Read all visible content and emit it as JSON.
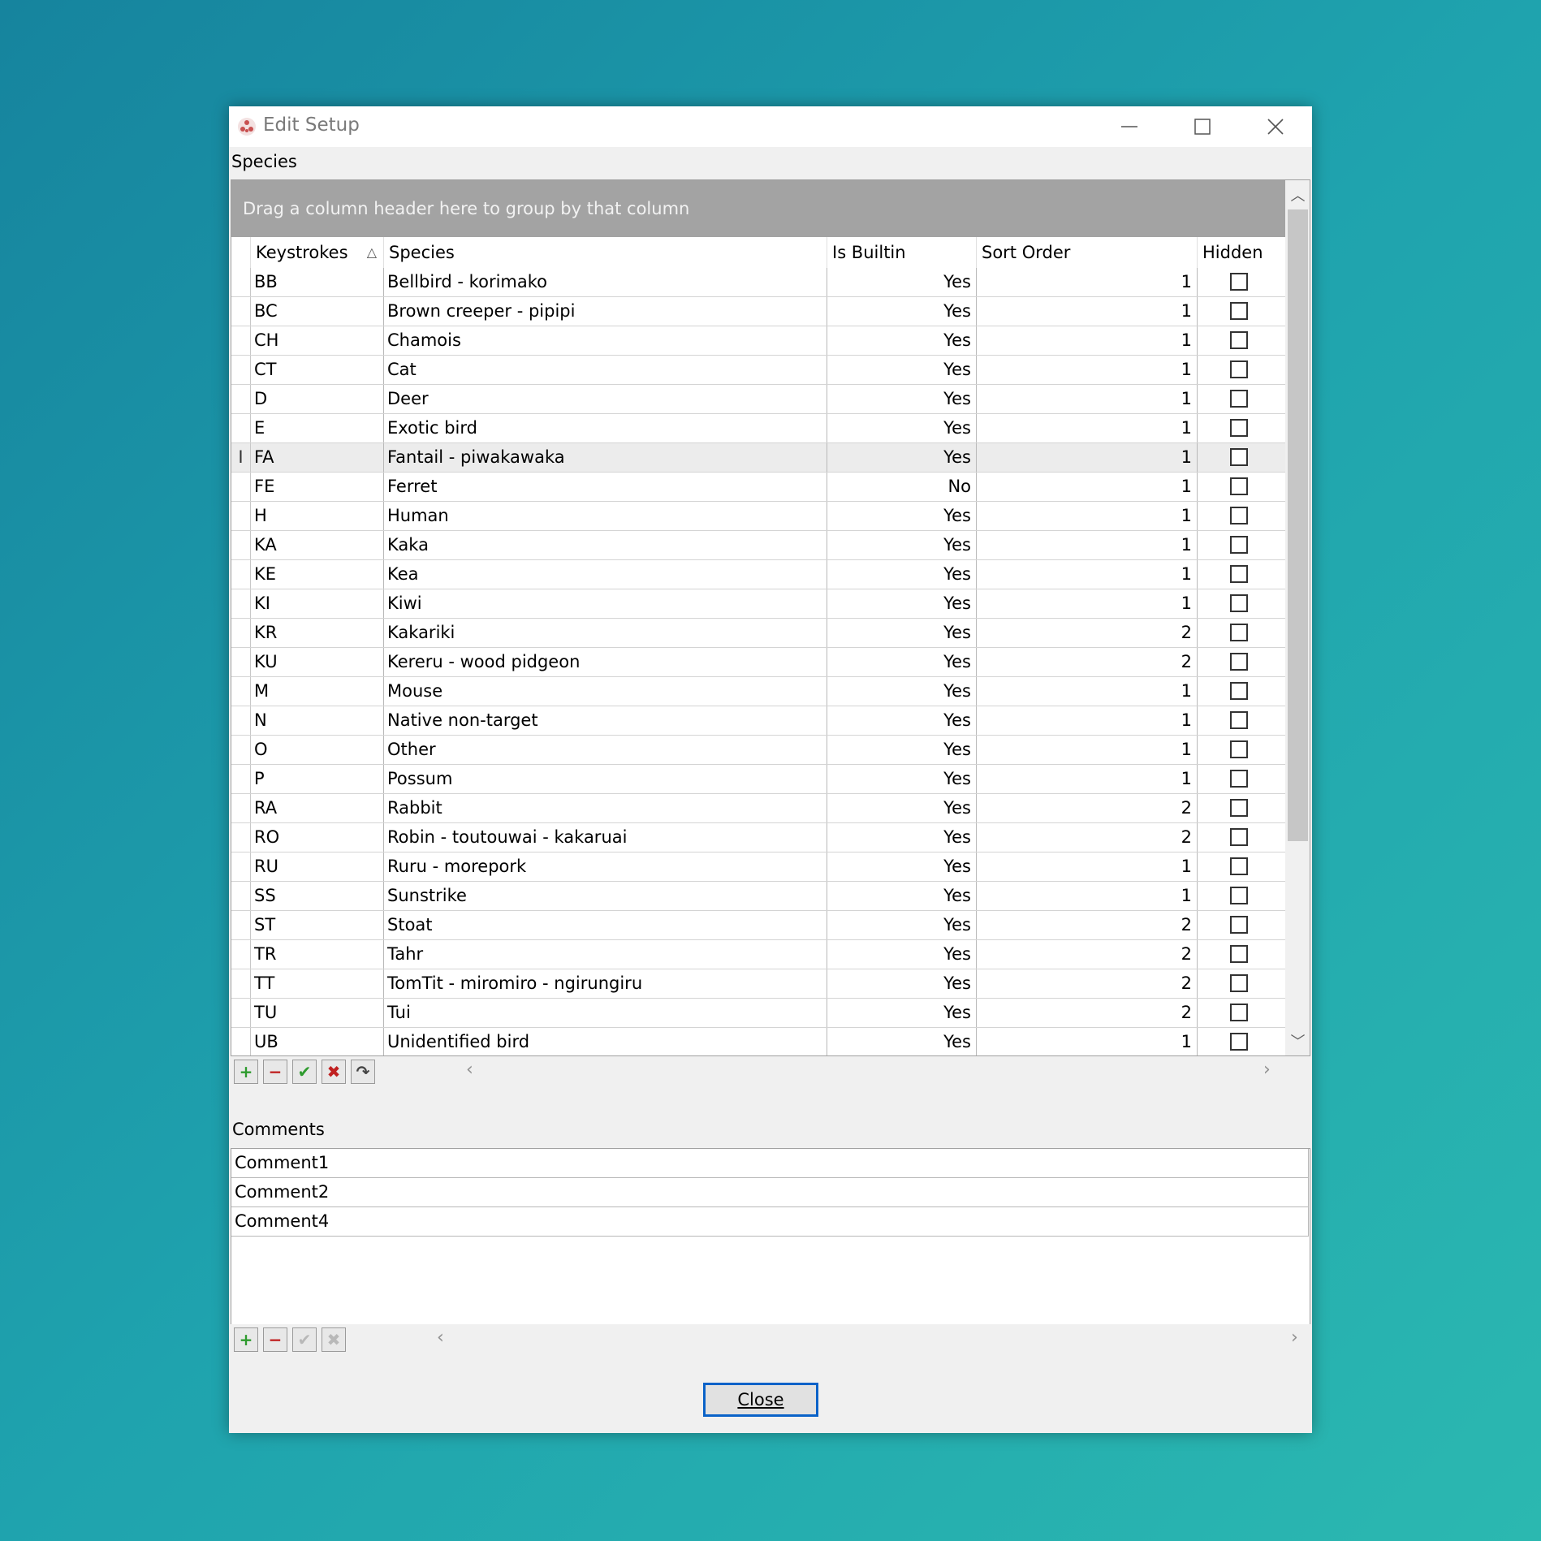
{
  "window": {
    "title": "Edit Setup"
  },
  "species_section": {
    "label": "Species",
    "group_hint": "Drag a column header here to group by that column",
    "columns": [
      "Keystrokes",
      "Species",
      "Is Builtin",
      "Sort Order",
      "Hidden"
    ],
    "sort_indicator": "△",
    "rows": [
      {
        "key": "BB",
        "species": "Bellbird - korimako",
        "builtin": "Yes",
        "sort": "1"
      },
      {
        "key": "BC",
        "species": "Brown creeper - pipipi",
        "builtin": "Yes",
        "sort": "1"
      },
      {
        "key": "CH",
        "species": "Chamois",
        "builtin": "Yes",
        "sort": "1"
      },
      {
        "key": "CT",
        "species": "Cat",
        "builtin": "Yes",
        "sort": "1"
      },
      {
        "key": "D",
        "species": "Deer",
        "builtin": "Yes",
        "sort": "1"
      },
      {
        "key": "E",
        "species": "Exotic bird",
        "builtin": "Yes",
        "sort": "1"
      },
      {
        "key": "FA",
        "species": "Fantail - piwakawaka",
        "builtin": "Yes",
        "sort": "1"
      },
      {
        "key": "FE",
        "species": "Ferret",
        "builtin": "No",
        "sort": "1"
      },
      {
        "key": "H",
        "species": "Human",
        "builtin": "Yes",
        "sort": "1"
      },
      {
        "key": "KA",
        "species": "Kaka",
        "builtin": "Yes",
        "sort": "1"
      },
      {
        "key": "KE",
        "species": "Kea",
        "builtin": "Yes",
        "sort": "1"
      },
      {
        "key": "KI",
        "species": "Kiwi",
        "builtin": "Yes",
        "sort": "1"
      },
      {
        "key": "KR",
        "species": "Kakariki",
        "builtin": "Yes",
        "sort": "2"
      },
      {
        "key": "KU",
        "species": "Kereru - wood pidgeon",
        "builtin": "Yes",
        "sort": "2"
      },
      {
        "key": "M",
        "species": "Mouse",
        "builtin": "Yes",
        "sort": "1"
      },
      {
        "key": "N",
        "species": "Native non-target",
        "builtin": "Yes",
        "sort": "1"
      },
      {
        "key": "O",
        "species": "Other",
        "builtin": "Yes",
        "sort": "1"
      },
      {
        "key": "P",
        "species": "Possum",
        "builtin": "Yes",
        "sort": "1"
      },
      {
        "key": "RA",
        "species": "Rabbit",
        "builtin": "Yes",
        "sort": "2"
      },
      {
        "key": "RO",
        "species": "Robin - toutouwai - kakaruai",
        "builtin": "Yes",
        "sort": "2"
      },
      {
        "key": "RU",
        "species": "Ruru - morepork",
        "builtin": "Yes",
        "sort": "1"
      },
      {
        "key": "SS",
        "species": "Sunstrike",
        "builtin": "Yes",
        "sort": "1"
      },
      {
        "key": "ST",
        "species": "Stoat",
        "builtin": "Yes",
        "sort": "2"
      },
      {
        "key": "TR",
        "species": "Tahr",
        "builtin": "Yes",
        "sort": "2"
      },
      {
        "key": "TT",
        "species": "TomTit - miromiro - ngirungiru",
        "builtin": "Yes",
        "sort": "2"
      },
      {
        "key": "TU",
        "species": "Tui",
        "builtin": "Yes",
        "sort": "2"
      },
      {
        "key": "UB",
        "species": "Unidentified bird",
        "builtin": "Yes",
        "sort": "1"
      }
    ],
    "focused_row_marker": "I"
  },
  "comments_section": {
    "label": "Comments",
    "items": [
      "Comment1",
      "Comment2",
      "Comment4"
    ]
  },
  "close_button": {
    "label": "Close"
  }
}
